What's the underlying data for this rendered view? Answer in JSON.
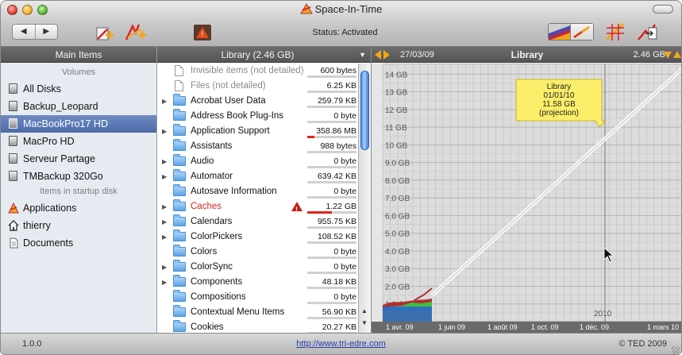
{
  "window": {
    "title": "Space-In-Time",
    "status": "Status: Activated"
  },
  "toolbar": {
    "back": "◀",
    "forward": "▶",
    "tools": [
      "add-disk-icon",
      "add-folder-icon",
      "alert-icon"
    ],
    "right_tools": [
      "chart-view-icon",
      "zoom-grid-icon",
      "export-chart-icon"
    ]
  },
  "sidebar": {
    "header": "Main Items",
    "section_volumes": "Volumes",
    "volumes": [
      {
        "label": "All Disks"
      },
      {
        "label": "Backup_Leopard"
      },
      {
        "label": "MacBookPro17 HD"
      },
      {
        "label": "MacPro HD"
      },
      {
        "label": "Serveur Partage"
      },
      {
        "label": "TMBackup 320Go"
      }
    ],
    "section_startup": "Items in startup disk",
    "startup_items": [
      {
        "label": "Applications"
      },
      {
        "label": "thierry"
      },
      {
        "label": "Documents"
      }
    ]
  },
  "list": {
    "header": "Library (2.46 GB)",
    "rows": [
      {
        "name": "Invisible items (not detailed)",
        "size": "600 bytes",
        "bar": 0,
        "folder": false,
        "style": "dim",
        "expandable": false
      },
      {
        "name": "Files (not detailed)",
        "size": "6.25 KB",
        "bar": 0,
        "folder": false,
        "style": "dim",
        "expandable": false
      },
      {
        "name": "Acrobat User Data",
        "size": "259.79 KB",
        "bar": 0,
        "folder": true,
        "style": "",
        "expandable": true
      },
      {
        "name": "Address Book Plug-Ins",
        "size": "0 byte",
        "bar": 0,
        "folder": true,
        "style": "",
        "expandable": false
      },
      {
        "name": "Application Support",
        "size": "358.86 MB",
        "bar": 0.15,
        "folder": true,
        "style": "",
        "expandable": true
      },
      {
        "name": "Assistants",
        "size": "988 bytes",
        "bar": 0,
        "folder": true,
        "style": "",
        "expandable": false
      },
      {
        "name": "Audio",
        "size": "0 byte",
        "bar": 0,
        "folder": true,
        "style": "",
        "expandable": true
      },
      {
        "name": "Automator",
        "size": "639.42 KB",
        "bar": 0,
        "folder": true,
        "style": "",
        "expandable": true
      },
      {
        "name": "Autosave Information",
        "size": "0 byte",
        "bar": 0,
        "folder": true,
        "style": "",
        "expandable": false
      },
      {
        "name": "Caches",
        "size": "1.22 GB",
        "bar": 0.5,
        "folder": true,
        "style": "red",
        "expandable": true,
        "warning": true
      },
      {
        "name": "Calendars",
        "size": "955.75 KB",
        "bar": 0,
        "folder": true,
        "style": "",
        "expandable": true
      },
      {
        "name": "ColorPickers",
        "size": "108.52 KB",
        "bar": 0,
        "folder": true,
        "style": "",
        "expandable": true
      },
      {
        "name": "Colors",
        "size": "0 byte",
        "bar": 0,
        "folder": true,
        "style": "",
        "expandable": false
      },
      {
        "name": "ColorSync",
        "size": "0 byte",
        "bar": 0,
        "folder": true,
        "style": "",
        "expandable": true
      },
      {
        "name": "Components",
        "size": "48.18 KB",
        "bar": 0,
        "folder": true,
        "style": "",
        "expandable": true
      },
      {
        "name": "Compositions",
        "size": "0 byte",
        "bar": 0,
        "folder": true,
        "style": "",
        "expandable": false
      },
      {
        "name": "Contextual Menu Items",
        "size": "56.90 KB",
        "bar": 0,
        "folder": true,
        "style": "",
        "expandable": false
      },
      {
        "name": "Cookies",
        "size": "20.27 KB",
        "bar": 0,
        "folder": true,
        "style": "",
        "expandable": false
      }
    ]
  },
  "chart": {
    "date": "27/03/09",
    "title": "Library",
    "size": "2.46 GB",
    "tooltip": [
      "Library",
      "01/01/10",
      "11.58 GB",
      "(projection)"
    ],
    "year_marker": "2010"
  },
  "chart_data": {
    "type": "area",
    "title": "Library",
    "y_ticks": [
      "14 GB",
      "13 GB",
      "12 GB",
      "11 GB",
      "10 GB",
      "9.0 GB",
      "8.0 GB",
      "7.0 GB",
      "6.0 GB",
      "5.0 GB",
      "4.0 GB",
      "3.0 GB",
      "2.0 GB",
      "1.0 GB"
    ],
    "x_ticks": [
      "1 avr. 09",
      "1 juin 09",
      "1 août 09",
      "1 oct. 09",
      "1 déc. 09",
      "1 mars 10"
    ],
    "ylim": [
      0,
      14.6
    ],
    "projection": {
      "from": [
        "27/03/09",
        2.46
      ],
      "to": [
        "01/01/10",
        11.58
      ]
    },
    "grid": true
  },
  "footer": {
    "version": "1.0.0",
    "url": "http://www.tri-edre.com",
    "copyright": "© TED 2009"
  }
}
